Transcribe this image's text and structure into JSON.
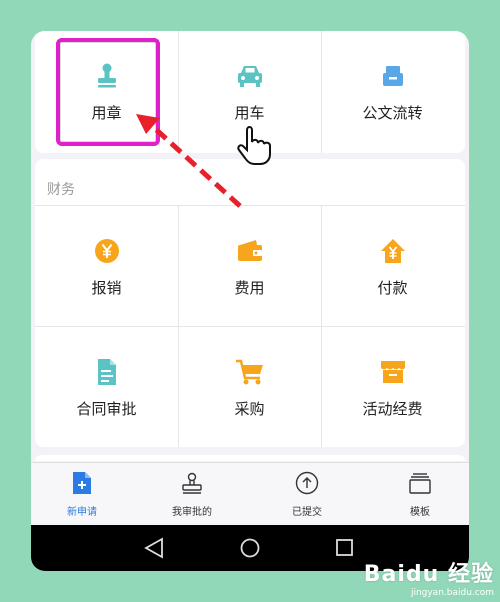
{
  "colors": {
    "background": "#90d8b8",
    "teal_icon": "#5bc3c3",
    "orange_icon": "#f7a51c",
    "blue_icon": "#5aa7e8",
    "active_tab": "#2a7be4",
    "highlight_frame": "#e020c8",
    "arrow": "#e8202a"
  },
  "top_row": [
    {
      "label": "用章",
      "icon": "stamp-icon"
    },
    {
      "label": "用车",
      "icon": "car-icon"
    },
    {
      "label": "公文流转",
      "icon": "document-tray-icon"
    }
  ],
  "finance": {
    "title": "财务",
    "items": [
      {
        "label": "报销",
        "icon": "yen-coin-icon"
      },
      {
        "label": "费用",
        "icon": "wallet-icon"
      },
      {
        "label": "付款",
        "icon": "yen-house-icon"
      },
      {
        "label": "合同审批",
        "icon": "contract-document-icon"
      },
      {
        "label": "采购",
        "icon": "shopping-cart-icon"
      },
      {
        "label": "活动经费",
        "icon": "shop-icon"
      }
    ]
  },
  "tabbar": [
    {
      "label": "新申请",
      "icon": "new-document-icon",
      "active": true
    },
    {
      "label": "我审批的",
      "icon": "stamp-outline-icon",
      "active": false
    },
    {
      "label": "已提交",
      "icon": "arrow-up-circle-icon",
      "active": false
    },
    {
      "label": "模板",
      "icon": "template-stack-icon",
      "active": false
    }
  ],
  "navbar": [
    "back-triangle-icon",
    "home-circle-icon",
    "recents-square-icon"
  ],
  "watermark": {
    "logo": "Baidu 经验",
    "url": "jingyan.baidu.com"
  }
}
